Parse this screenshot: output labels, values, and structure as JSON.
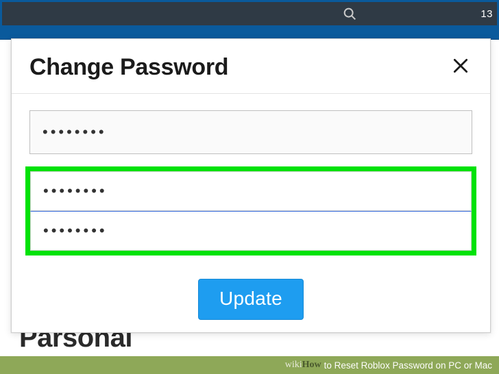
{
  "topbar": {
    "number": "13"
  },
  "background": {
    "heading_fragment": "Parsonal"
  },
  "modal": {
    "title": "Change Password",
    "fields": {
      "current": "••••••••",
      "new": "••••••••",
      "confirm": "••••••••"
    },
    "update_label": "Update"
  },
  "caption": {
    "brand_wiki": "wiki",
    "brand_how": "How",
    "text": " to Reset Roblox Password on PC or Mac"
  }
}
